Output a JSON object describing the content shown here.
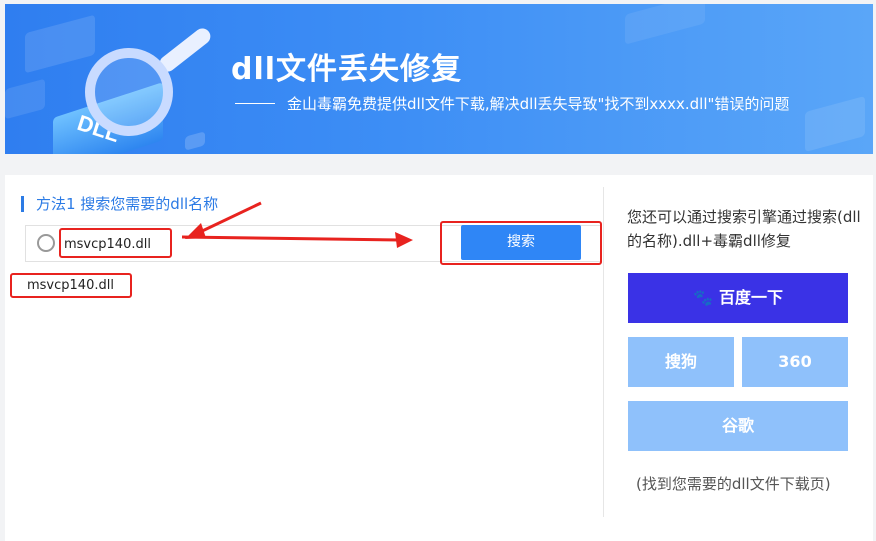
{
  "banner": {
    "title": "dll文件丢失修复",
    "subtitle": "金山毒霸免费提供dll文件下载,解决dll丢失导致\"找不到xxxx.dll\"错误的问题",
    "logo_text": "DLL"
  },
  "method": {
    "title": "方法1 搜索您需要的dll名称"
  },
  "search": {
    "value": "msvcp140.dll",
    "button_label": "搜索"
  },
  "results": [
    {
      "label": "msvcp140.dll"
    }
  ],
  "engines": {
    "description": "您还可以通过搜索引擎通过搜索(dll的名称).dll+毒霸dll修复",
    "baidu_label": "百度一下",
    "sogou_label": "搜狗",
    "s360_label": "360",
    "google_label": "谷歌",
    "footer": "(找到您需要的dll文件下载页)"
  },
  "colors": {
    "accent": "#2f86f6",
    "baidu": "#3a32e6",
    "engine_light": "#8fc1fb",
    "annotation_red": "#e8231f"
  },
  "icons": {
    "search": "search-icon",
    "baidu": "paw-icon"
  }
}
